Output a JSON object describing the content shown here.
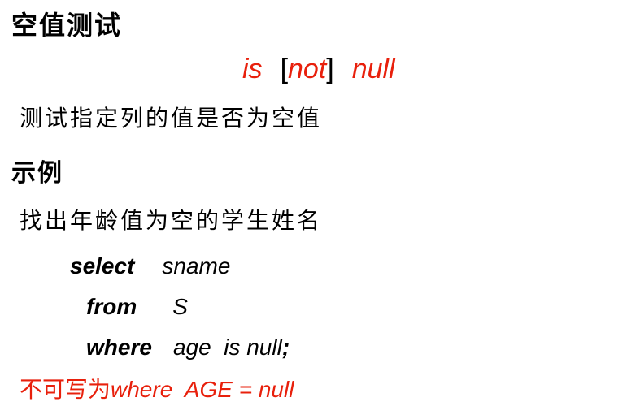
{
  "title": "空值测试",
  "syntax": {
    "is": "is",
    "open_bracket": "[",
    "not": "not",
    "close_bracket": "]",
    "null": "null"
  },
  "description": "测试指定列的值是否为空值",
  "example_heading": "示例",
  "task": "找出年龄值为空的学生姓名",
  "code": {
    "select_kw": "select",
    "select_col": "sname",
    "from_kw": "from",
    "from_table": "S",
    "where_kw": "where",
    "where_cond": "age  is null",
    "terminator": ";"
  },
  "warning": {
    "prefix": "不可写为",
    "expression": "where  AGE = null"
  },
  "colors": {
    "accent_red": "#e8200c",
    "text": "#000000",
    "background": "#ffffff"
  }
}
